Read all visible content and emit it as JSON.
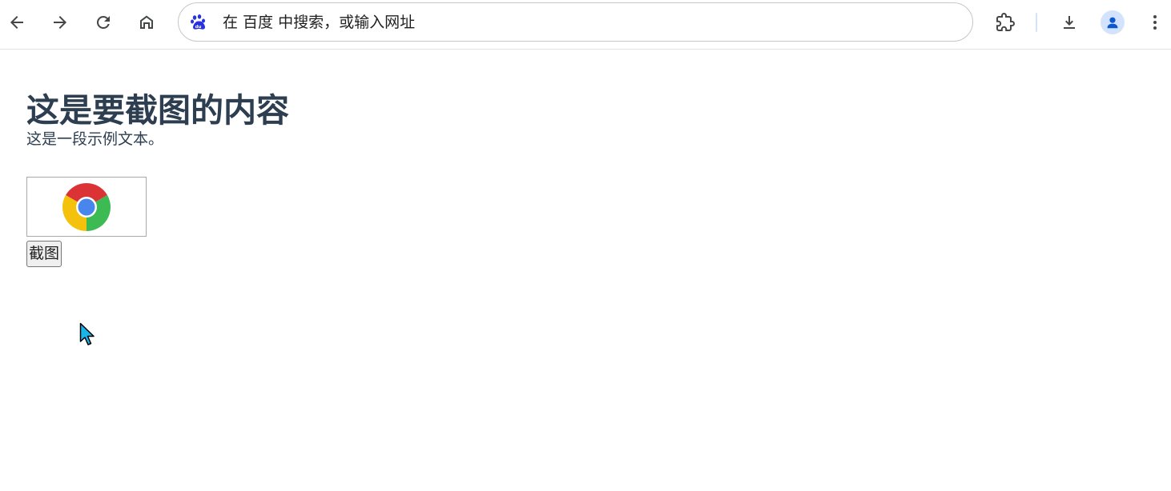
{
  "browser": {
    "omnibox": {
      "search_engine_icon": "baidu-paw-icon",
      "placeholder": "在 百度 中搜索，或输入网址"
    },
    "toolbar_icons": {
      "back": "arrow-left-icon",
      "forward": "arrow-right-icon",
      "reload": "reload-icon",
      "home": "home-icon",
      "extensions": "puzzle-icon",
      "download": "download-icon",
      "profile": "person-icon",
      "menu": "more-vertical-icon"
    },
    "colors": {
      "accent": "#1a73e8",
      "baidu_blue": "#2932e1",
      "avatar_bg": "#d3e3fd",
      "icon_color": "#444746"
    }
  },
  "page": {
    "title": "这是要截图的内容",
    "text": "这是一段示例文本。",
    "image_icon": "chrome-logo-icon",
    "capture_button_label": "截图",
    "colors": {
      "heading": "#2c3e50",
      "chrome_red": "#db3236",
      "chrome_yellow": "#f4c20d",
      "chrome_green": "#3cba54",
      "chrome_blue": "#4885ed",
      "cursor": "#1ab5e8"
    }
  }
}
